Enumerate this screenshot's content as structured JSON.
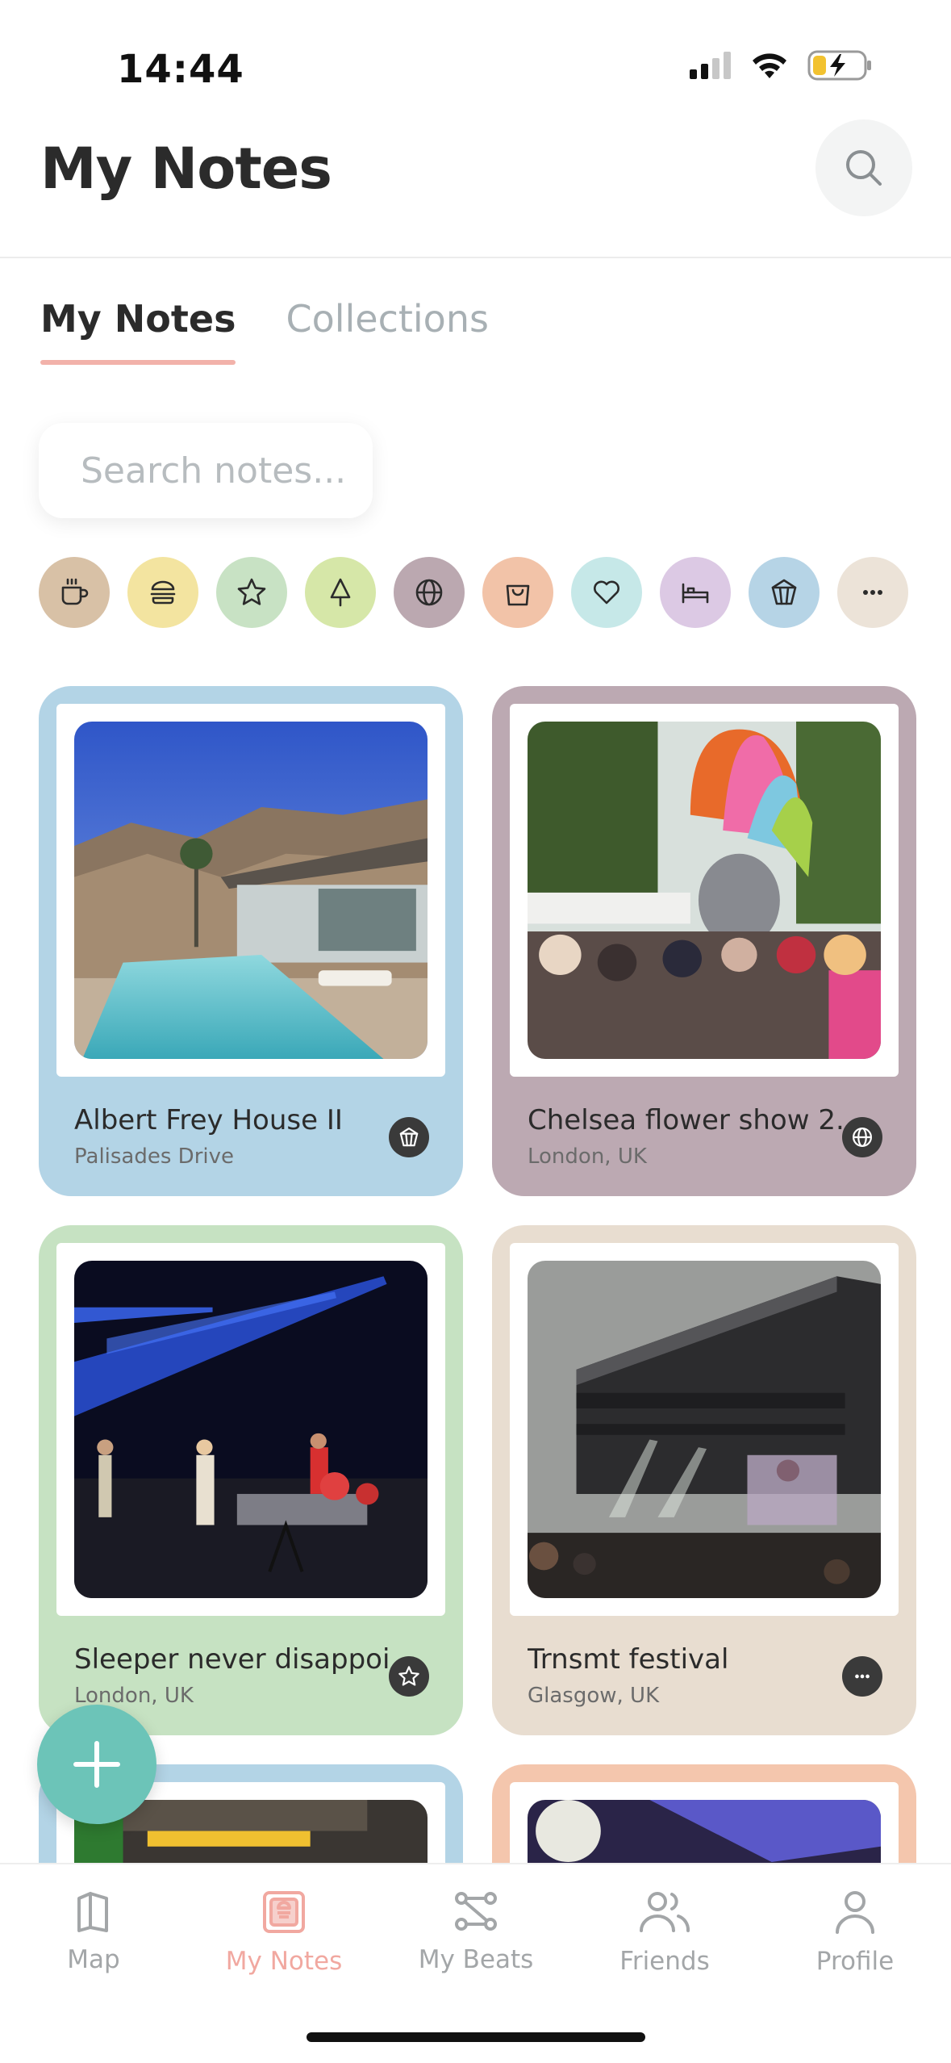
{
  "status_bar": {
    "time": "14:44"
  },
  "header": {
    "title": "My Notes"
  },
  "tabs": [
    {
      "label": "My Notes",
      "active": true
    },
    {
      "label": "Collections",
      "active": false
    }
  ],
  "search": {
    "placeholder": "Search notes..."
  },
  "filters": [
    {
      "icon": "coffee-icon",
      "color": "#d8c1a6"
    },
    {
      "icon": "burger-icon",
      "color": "#f3e4a0"
    },
    {
      "icon": "star-icon",
      "color": "#c8e2c4"
    },
    {
      "icon": "tree-icon",
      "color": "#d6e7a8"
    },
    {
      "icon": "globe-icon",
      "color": "#bba8b0"
    },
    {
      "icon": "shopping-bag-icon",
      "color": "#f2c3a8"
    },
    {
      "icon": "heart-icon",
      "color": "#c6e8e8"
    },
    {
      "icon": "bed-icon",
      "color": "#dcc9e4"
    },
    {
      "icon": "landmark-icon",
      "color": "#b6d4e6"
    },
    {
      "icon": "more-icon",
      "color": "#ece3d8"
    }
  ],
  "notes": [
    {
      "title": "Albert Frey House II",
      "subtitle": "Palisades Drive",
      "color": "#b3d4e6",
      "badge_icon": "landmark-icon"
    },
    {
      "title": "Chelsea flower show 2...",
      "subtitle": "London, UK",
      "color": "#bca9b2",
      "badge_icon": "globe-icon"
    },
    {
      "title": "Sleeper never disappoi...",
      "subtitle": "London, UK",
      "color": "#c6e2c2",
      "badge_icon": "star-icon"
    },
    {
      "title": "Trnsmt festival",
      "subtitle": "Glasgow, UK",
      "color": "#e8ddd0",
      "badge_icon": "more-icon"
    },
    {
      "title": "",
      "subtitle": "",
      "color": "#b3d4e6",
      "badge_icon": ""
    },
    {
      "title": "",
      "subtitle": "",
      "color": "#f4c6ad",
      "badge_icon": ""
    }
  ],
  "tabbar": [
    {
      "label": "Map",
      "icon": "map-icon",
      "active": false
    },
    {
      "label": "My Notes",
      "icon": "notes-icon",
      "active": true
    },
    {
      "label": "My Beats",
      "icon": "beats-icon",
      "active": false
    },
    {
      "label": "Friends",
      "icon": "friends-icon",
      "active": false
    },
    {
      "label": "Profile",
      "icon": "profile-icon",
      "active": false
    }
  ]
}
